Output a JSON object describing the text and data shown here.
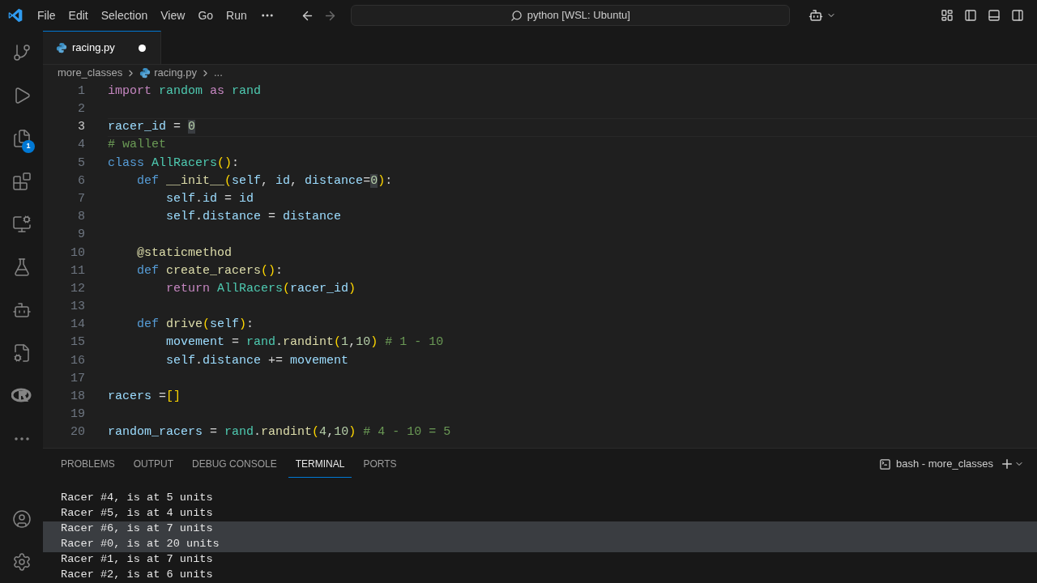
{
  "menu": [
    "File",
    "Edit",
    "Selection",
    "View",
    "Go",
    "Run"
  ],
  "command_center": "python [WSL: Ubuntu]",
  "explorer_badge": "1",
  "tabs": [
    {
      "label": "racing.py",
      "selected": true,
      "dirty": true
    }
  ],
  "breadcrumb": [
    {
      "label": "more_classes",
      "kind": "folder"
    },
    {
      "label": "racing.py",
      "kind": "file"
    },
    {
      "label": "...",
      "kind": "symbol"
    }
  ],
  "editor": {
    "lines": [
      {
        "number": "1",
        "current": false,
        "tokens": [
          {
            "kind": "ctrl",
            "text": "import"
          },
          {
            "kind": "mod",
            "text": " random"
          },
          {
            "kind": "ctrl",
            "text": " as"
          },
          {
            "kind": "mod",
            "text": " rand"
          }
        ]
      },
      {
        "number": "2",
        "current": false
      },
      {
        "number": "3",
        "current": true,
        "tokens": [
          {
            "kind": "var",
            "text": "racer_id"
          },
          {
            "kind": "op",
            "text": " = "
          },
          {
            "kind": "numhl",
            "text": "0"
          }
        ]
      },
      {
        "number": "4",
        "current": false,
        "tokens": [
          {
            "kind": "cmt",
            "text": "# wallet"
          }
        ]
      },
      {
        "number": "5",
        "current": false,
        "tokens": [
          {
            "kind": "kw",
            "text": "class"
          },
          {
            "kind": "mod",
            "text": " AllRacers"
          },
          {
            "kind": "par",
            "text": "()"
          },
          {
            "kind": "op",
            "text": ":"
          }
        ]
      },
      {
        "number": "6",
        "current": false,
        "tokens": [
          {
            "kind": "kw",
            "text": "    def"
          },
          {
            "kind": "fn",
            "text": " __init__"
          },
          {
            "kind": "par",
            "text": "("
          },
          {
            "kind": "var",
            "text": "self"
          },
          {
            "kind": "op",
            "text": ", "
          },
          {
            "kind": "var",
            "text": "id"
          },
          {
            "kind": "op",
            "text": ", "
          },
          {
            "kind": "var",
            "text": "distance"
          },
          {
            "kind": "op",
            "text": "="
          },
          {
            "kind": "numhl",
            "text": "0"
          },
          {
            "kind": "par",
            "text": ")"
          },
          {
            "kind": "op",
            "text": ":"
          }
        ]
      },
      {
        "number": "7",
        "current": false,
        "tokens": [
          {
            "kind": "var",
            "text": "        self"
          },
          {
            "kind": "op",
            "text": "."
          },
          {
            "kind": "var",
            "text": "id"
          },
          {
            "kind": "op",
            "text": " = "
          },
          {
            "kind": "var",
            "text": "id"
          }
        ]
      },
      {
        "number": "8",
        "current": false,
        "tokens": [
          {
            "kind": "var",
            "text": "        self"
          },
          {
            "kind": "op",
            "text": "."
          },
          {
            "kind": "var",
            "text": "distance"
          },
          {
            "kind": "op",
            "text": " = "
          },
          {
            "kind": "var",
            "text": "distance"
          }
        ]
      },
      {
        "number": "9",
        "current": false
      },
      {
        "number": "10",
        "current": false,
        "tokens": [
          {
            "kind": "fn",
            "text": "    @staticmethod"
          }
        ]
      },
      {
        "number": "11",
        "current": false,
        "tokens": [
          {
            "kind": "kw",
            "text": "    def"
          },
          {
            "kind": "fn",
            "text": " create_racers"
          },
          {
            "kind": "par",
            "text": "()"
          },
          {
            "kind": "op",
            "text": ":"
          }
        ]
      },
      {
        "number": "12",
        "current": false,
        "tokens": [
          {
            "kind": "ctrl",
            "text": "        return"
          },
          {
            "kind": "mod",
            "text": " AllRacers"
          },
          {
            "kind": "par",
            "text": "("
          },
          {
            "kind": "var",
            "text": "racer_id"
          },
          {
            "kind": "par",
            "text": ")"
          }
        ]
      },
      {
        "number": "13",
        "current": false
      },
      {
        "number": "14",
        "current": false,
        "tokens": [
          {
            "kind": "kw",
            "text": "    def"
          },
          {
            "kind": "fn",
            "text": " drive"
          },
          {
            "kind": "par",
            "text": "("
          },
          {
            "kind": "var",
            "text": "self"
          },
          {
            "kind": "par",
            "text": ")"
          },
          {
            "kind": "op",
            "text": ":"
          }
        ]
      },
      {
        "number": "15",
        "current": false,
        "tokens": [
          {
            "kind": "var",
            "text": "        movement"
          },
          {
            "kind": "op",
            "text": " = "
          },
          {
            "kind": "mod",
            "text": "rand"
          },
          {
            "kind": "op",
            "text": "."
          },
          {
            "kind": "fn",
            "text": "randint"
          },
          {
            "kind": "par",
            "text": "("
          },
          {
            "kind": "num",
            "text": "1"
          },
          {
            "kind": "op",
            "text": ","
          },
          {
            "kind": "num",
            "text": "10"
          },
          {
            "kind": "par",
            "text": ")"
          },
          {
            "kind": "cmt",
            "text": " # 1 - 10"
          }
        ]
      },
      {
        "number": "16",
        "current": false,
        "tokens": [
          {
            "kind": "var",
            "text": "        self"
          },
          {
            "kind": "op",
            "text": "."
          },
          {
            "kind": "var",
            "text": "distance"
          },
          {
            "kind": "op",
            "text": " += "
          },
          {
            "kind": "var",
            "text": "movement"
          }
        ]
      },
      {
        "number": "17",
        "current": false
      },
      {
        "number": "18",
        "current": false,
        "tokens": [
          {
            "kind": "var",
            "text": "racers"
          },
          {
            "kind": "op",
            "text": " ="
          },
          {
            "kind": "par",
            "text": "[]"
          }
        ]
      },
      {
        "number": "19",
        "current": false
      },
      {
        "number": "20",
        "current": false,
        "tokens": [
          {
            "kind": "var",
            "text": "random_racers"
          },
          {
            "kind": "op",
            "text": " = "
          },
          {
            "kind": "mod",
            "text": "rand"
          },
          {
            "kind": "op",
            "text": "."
          },
          {
            "kind": "fn",
            "text": "randint"
          },
          {
            "kind": "par",
            "text": "("
          },
          {
            "kind": "num",
            "text": "4"
          },
          {
            "kind": "op",
            "text": ","
          },
          {
            "kind": "num",
            "text": "10"
          },
          {
            "kind": "par",
            "text": ")"
          },
          {
            "kind": "cmt",
            "text": " # 4 - 10 = 5"
          }
        ]
      }
    ]
  },
  "panel": {
    "tabs": [
      {
        "label": "PROBLEMS",
        "selected": false
      },
      {
        "label": "OUTPUT",
        "selected": false
      },
      {
        "label": "DEBUG CONSOLE",
        "selected": false
      },
      {
        "label": "TERMINAL",
        "selected": true
      },
      {
        "label": "PORTS",
        "selected": false
      }
    ],
    "terminal_name": "bash - more_classes",
    "terminal_lines": [
      {
        "text": "Racer #4, is at 5 units",
        "selected": false
      },
      {
        "text": "Racer #5, is at 4 units",
        "selected": false
      },
      {
        "text": "Racer #6, is at 7 units",
        "selected": true
      },
      {
        "text": "Racer #0, is at 20 units",
        "selected": true
      },
      {
        "text": "Racer #1, is at 7 units",
        "selected": false
      },
      {
        "text": "Racer #2, is at 6 units",
        "selected": false
      }
    ]
  }
}
